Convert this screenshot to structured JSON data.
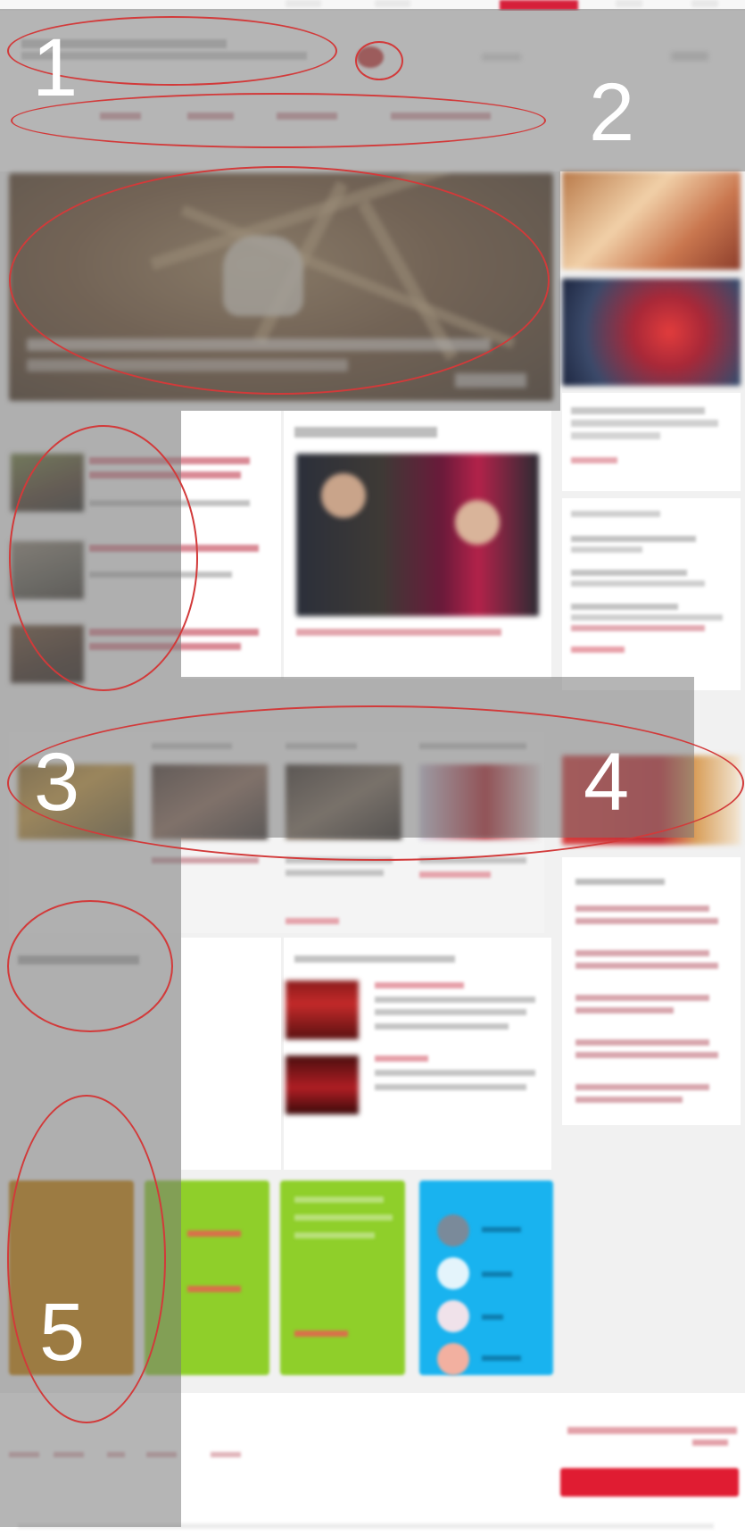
{
  "header": {
    "logo_line1": "",
    "logo_line2": "",
    "nav": [
      "",
      "",
      "",
      ""
    ]
  },
  "colors": {
    "accent_red": "#e01c32",
    "overlay_gray": "#8e8e8e",
    "tile_orange": "#c77f00",
    "tile_green": "#8fcf2a",
    "tile_blue": "#19b3ef"
  },
  "annotations": {
    "one": "1",
    "two": "2",
    "three": "3",
    "four": "4",
    "five": "5"
  }
}
